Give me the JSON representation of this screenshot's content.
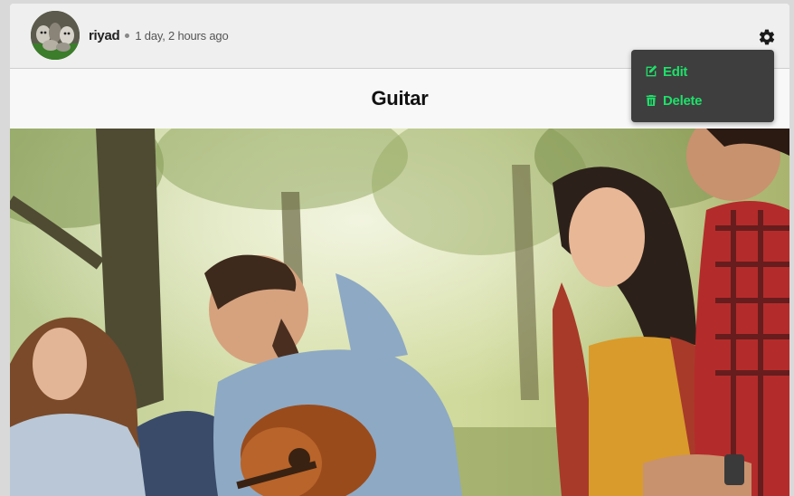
{
  "post": {
    "author": "riyad",
    "time_ago": "1 day, 2 hours ago",
    "title": "Guitar"
  },
  "menu": {
    "edit_label": "Edit",
    "delete_label": "Delete"
  },
  "colors": {
    "menu_accent": "#1fe06a",
    "menu_background": "#3e3e3e",
    "header_background": "#efefef"
  },
  "icons": {
    "settings": "gear-icon",
    "edit": "edit-icon",
    "delete": "trash-icon"
  }
}
